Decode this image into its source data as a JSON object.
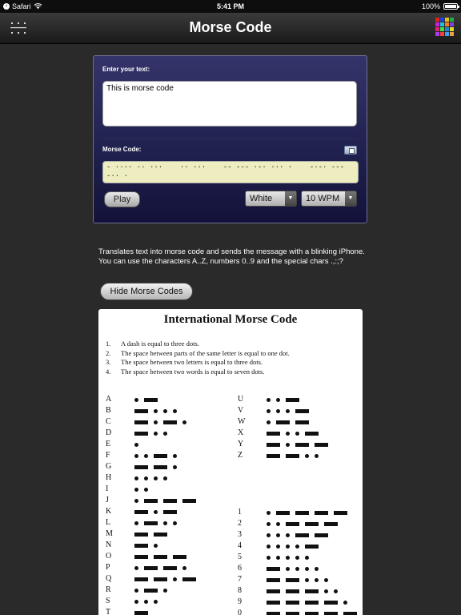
{
  "status_bar": {
    "back_app": "Safari",
    "time": "5:41 PM",
    "battery": "100%",
    "battery_level": 1.0
  },
  "nav": {
    "title": "Morse Code"
  },
  "panel": {
    "input_label": "Enter your text:",
    "input_value": "This is morse code",
    "morse_label": "Morse Code:",
    "morse_output": "- ···· ·· ···    ·· ···    -- --- ·-· ··· ·    -·-· ---\n-·· ·",
    "play_label": "Play",
    "color_value": "White",
    "speed_value": "10 WPM"
  },
  "description": {
    "line1": "Translates text into morse code and sends the message with a blinking iPhone.",
    "line2": "You can use the characters A..Z, numbers 0..9 and the special chars .,:;?"
  },
  "hide_button": "Hide Morse Codes",
  "chart": {
    "title": "International Morse Code",
    "rules": [
      {
        "num": "1.",
        "text": "A dash is equal to three dots."
      },
      {
        "num": "2.",
        "text": "The space between parts of the same letter is equal to one dot."
      },
      {
        "num": "3.",
        "text": "The space between two letters is equal to three dots."
      },
      {
        "num": "4.",
        "text": "The space between two words is equal to seven dots."
      }
    ],
    "left_column": [
      {
        "ch": "A",
        "code": ".-"
      },
      {
        "ch": "B",
        "code": "-..."
      },
      {
        "ch": "C",
        "code": "-.-."
      },
      {
        "ch": "D",
        "code": "-.."
      },
      {
        "ch": "E",
        "code": "."
      },
      {
        "ch": "F",
        "code": "..-."
      },
      {
        "ch": "G",
        "code": "--."
      },
      {
        "ch": "H",
        "code": "...."
      },
      {
        "ch": "I",
        "code": ".."
      },
      {
        "ch": "J",
        "code": ".---"
      },
      {
        "ch": "K",
        "code": "-.-"
      },
      {
        "ch": "L",
        "code": ".-.."
      },
      {
        "ch": "M",
        "code": "--"
      },
      {
        "ch": "N",
        "code": "-."
      },
      {
        "ch": "O",
        "code": "---"
      },
      {
        "ch": "P",
        "code": ".--."
      },
      {
        "ch": "Q",
        "code": "--.-"
      },
      {
        "ch": "R",
        "code": ".-."
      },
      {
        "ch": "S",
        "code": "..."
      },
      {
        "ch": "T",
        "code": "-"
      }
    ],
    "right_top": [
      {
        "ch": "U",
        "code": "..-"
      },
      {
        "ch": "V",
        "code": "...-"
      },
      {
        "ch": "W",
        "code": ".--"
      },
      {
        "ch": "X",
        "code": "-..-"
      },
      {
        "ch": "Y",
        "code": "-.--"
      },
      {
        "ch": "Z",
        "code": "--.."
      }
    ],
    "right_bottom": [
      {
        "ch": "1",
        "code": ".----"
      },
      {
        "ch": "2",
        "code": "..---"
      },
      {
        "ch": "3",
        "code": "...--"
      },
      {
        "ch": "4",
        "code": "....-"
      },
      {
        "ch": "5",
        "code": "....."
      },
      {
        "ch": "6",
        "code": "-...."
      },
      {
        "ch": "7",
        "code": "--..."
      },
      {
        "ch": "8",
        "code": "---.."
      },
      {
        "ch": "9",
        "code": "----."
      },
      {
        "ch": "0",
        "code": "-----"
      }
    ]
  },
  "colors": {
    "background": "#2a2a2a",
    "panel_top": "#34346a",
    "panel_bottom": "#12123a",
    "morse_field": "#ededbf",
    "grid_icon": [
      "#e02020",
      "#2040e0",
      "#e0c020",
      "#20b040",
      "#d020d0",
      "#20c0e0",
      "#f08020",
      "#8040e0",
      "#e02080",
      "#40e040",
      "#2080e0",
      "#e0e020",
      "#a040f0",
      "#f04040",
      "#40a0f0",
      "#f0a040"
    ]
  }
}
